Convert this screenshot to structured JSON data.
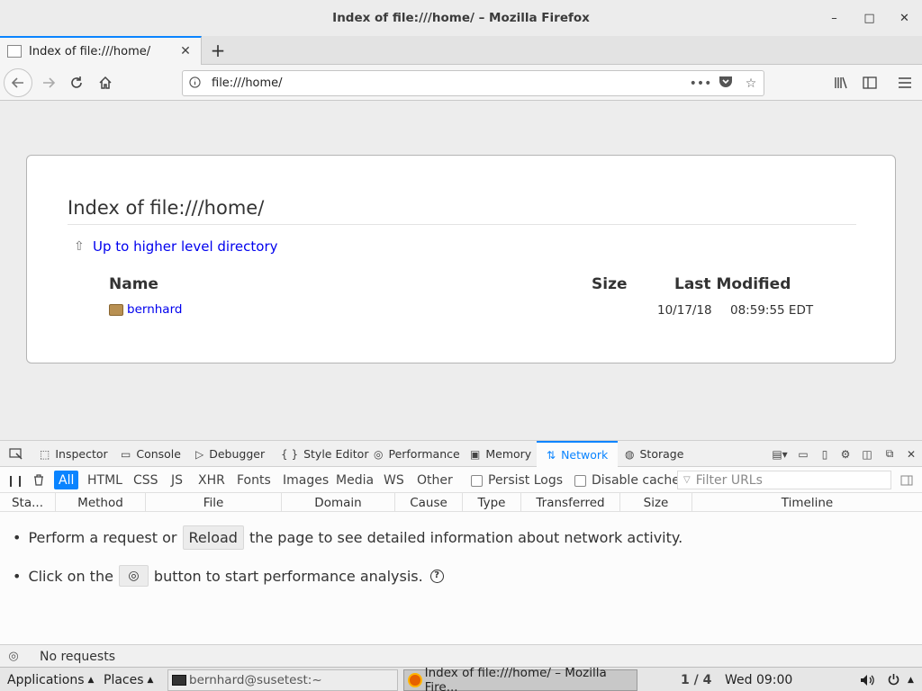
{
  "window": {
    "title": "Index of file:///home/ – Mozilla Firefox",
    "minimize_glyph": "–",
    "maximize_glyph": "□",
    "close_glyph": "✕"
  },
  "tabs": [
    {
      "label": "Index of file:///home/",
      "close_glyph": "✕",
      "active": true
    }
  ],
  "newtab_glyph": "+",
  "navbar": {
    "url": "file:///home/",
    "back_icon": "arrow-left-icon",
    "forward_icon": "arrow-right-icon",
    "reload_icon": "reload-icon",
    "home_icon": "home-icon"
  },
  "page": {
    "heading": "Index of file:///home/",
    "up_link": "Up to higher level directory",
    "columns": {
      "name": "Name",
      "size": "Size",
      "modified": "Last Modified"
    },
    "entries": [
      {
        "name": "bernhard",
        "size": "",
        "date": "10/17/18",
        "time": "08:59:55 EDT"
      }
    ]
  },
  "devtools": {
    "tabs": [
      "Inspector",
      "Console",
      "Debugger",
      "Style Editor",
      "Performance",
      "Memory",
      "Network",
      "Storage"
    ],
    "active_tab": "Network",
    "filters": [
      "All",
      "HTML",
      "CSS",
      "JS",
      "XHR",
      "Fonts",
      "Images",
      "Media",
      "WS",
      "Other"
    ],
    "active_filter": "All",
    "persist_logs": "Persist Logs",
    "disable_cache": "Disable cache",
    "filter_placeholder": "Filter URLs",
    "columns": [
      "Sta...",
      "Method",
      "File",
      "Domain",
      "Cause",
      "Type",
      "Transferred",
      "Size",
      "Timeline"
    ],
    "empty_msg1_before": "Perform a request or",
    "empty_msg1_button": "Reload",
    "empty_msg1_after": "the page to see detailed information about network activity.",
    "empty_msg2_before": "Click on the",
    "empty_msg2_after": "button to start performance analysis.",
    "status": "No requests"
  },
  "taskbar": {
    "applications": "Applications",
    "places": "Places",
    "window1": "bernhard@susetest:~",
    "window2": "Index of file:///home/ – Mozilla Fire...",
    "workspace": "1 / 4",
    "clock": "Wed 09:00"
  },
  "colors": {
    "accent": "#0a84ff",
    "link": "#0000ee"
  }
}
